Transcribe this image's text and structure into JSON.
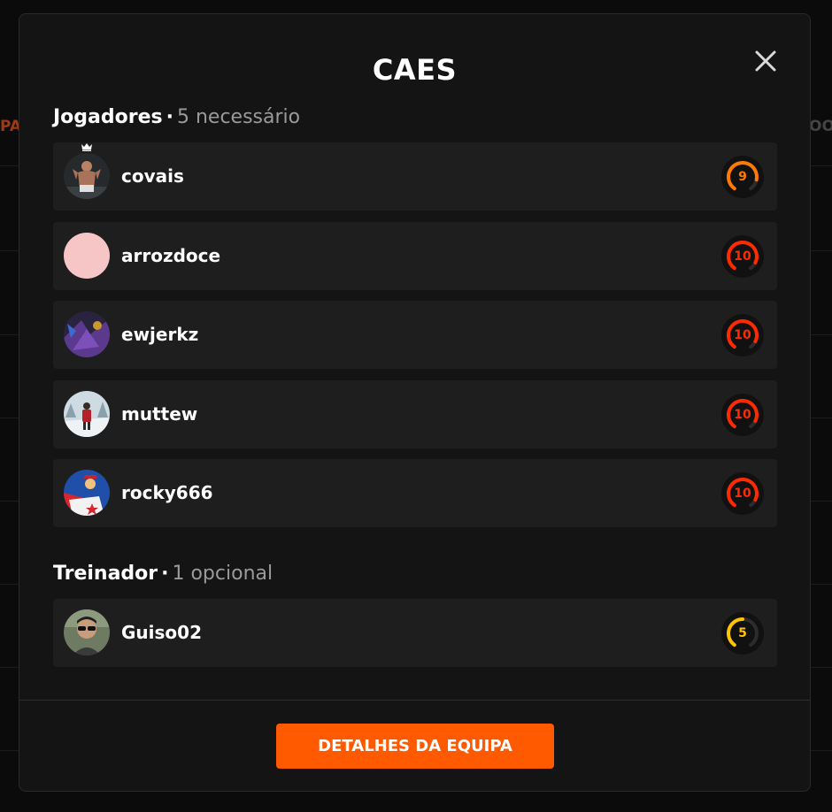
{
  "background": {
    "left_text": "PA",
    "right_text": "OO"
  },
  "modal": {
    "title": "CAES",
    "close_icon": "close-icon"
  },
  "players_section": {
    "title": "Jogadores",
    "separator": "·",
    "requirement": "5 necessário",
    "players": [
      {
        "name": "covais",
        "level": "9",
        "level_fraction": 0.85,
        "level_color": "#ff7a00",
        "captain": true,
        "avatar": "fighter-photo"
      },
      {
        "name": "arrozdoce",
        "level": "10",
        "level_fraction": 0.9,
        "level_color": "#ff2a00",
        "captain": false,
        "avatar": "plain-pink"
      },
      {
        "name": "ewjerkz",
        "level": "10",
        "level_fraction": 0.9,
        "level_color": "#ff2a00",
        "captain": false,
        "avatar": "purple-art"
      },
      {
        "name": "muttew",
        "level": "10",
        "level_fraction": 0.9,
        "level_color": "#ff2a00",
        "captain": false,
        "avatar": "snow-photo"
      },
      {
        "name": "rocky666",
        "level": "10",
        "level_fraction": 0.9,
        "level_color": "#ff2a00",
        "captain": false,
        "avatar": "caped-hero"
      }
    ]
  },
  "coach_section": {
    "title": "Treinador",
    "separator": "·",
    "requirement": "1 opcional",
    "coaches": [
      {
        "name": "Guiso02",
        "level": "5",
        "level_fraction": 0.5,
        "level_color": "#ffc400",
        "avatar": "sunglasses-photo"
      }
    ]
  },
  "footer": {
    "button_label": "DETALHES DA EQUIPA"
  },
  "colors": {
    "accent": "#ff5a00",
    "modal_bg": "#141414",
    "row_bg": "#1e1e1e"
  }
}
